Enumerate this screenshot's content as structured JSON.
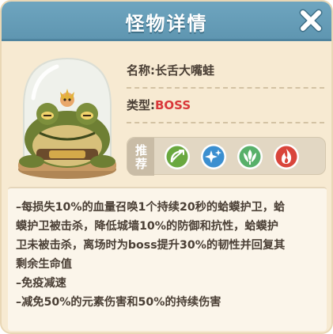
{
  "header": {
    "title": "怪物详情"
  },
  "monster": {
    "name_text": "名称:长舌大嘴蛙",
    "type_label": "类型:",
    "type_value": "BOSS"
  },
  "recommend": {
    "label": "推荐",
    "skills": [
      {
        "icon": "bow-icon",
        "color": "#6aa83f"
      },
      {
        "icon": "sparkle-icon",
        "color": "#3b8fd0"
      },
      {
        "icon": "leaf-burst-icon",
        "color": "#58b06a"
      },
      {
        "icon": "fire-icon",
        "color": "#d9453b"
      }
    ]
  },
  "description": {
    "lines": [
      "–每损失10%的血量召唤1个持续20秒的蛤蟆护卫，蛤",
      "蟆护卫被击杀，降低城墙10%的防御和抗性，蛤蟆护",
      "卫未被击杀，离场时为boss提升30%的韧性并回复其",
      "剩余生命值",
      "–免疫减速",
      "–减免50%的元素伤害和50%的持续伤害"
    ]
  }
}
